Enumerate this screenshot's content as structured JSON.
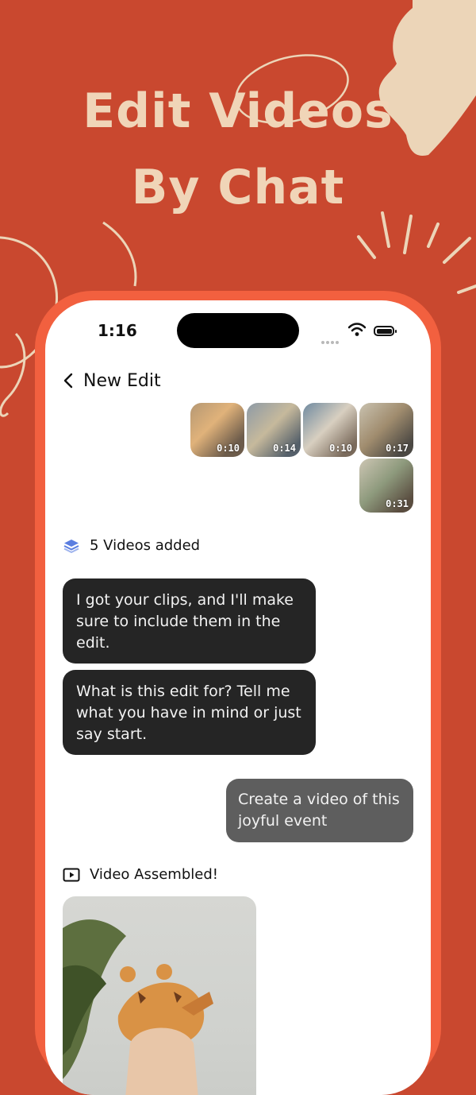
{
  "headline": {
    "line1": "Edit Videos",
    "line2": "By Chat"
  },
  "colors": {
    "background": "#c9482f",
    "phone_frame": "#f2603f",
    "headline": "#f0d5b8",
    "bot_bubble": "#252525",
    "user_bubble": "#5e5e5e"
  },
  "status_bar": {
    "time": "1:16",
    "icons": [
      "cellular-dots-icon",
      "wifi-icon",
      "battery-icon"
    ]
  },
  "nav": {
    "back_icon": "chevron-left-icon",
    "title": "New Edit"
  },
  "clips": [
    {
      "duration": "0:10"
    },
    {
      "duration": "0:14"
    },
    {
      "duration": "0:10"
    },
    {
      "duration": "0:17"
    },
    {
      "duration": "0:31"
    }
  ],
  "videos_added": {
    "icon": "stack-layers-icon",
    "label": "5 Videos added"
  },
  "messages": [
    {
      "from": "assistant",
      "text": "I got your clips, and I'll make sure to include them in the edit."
    },
    {
      "from": "assistant",
      "text": "What is this edit for? Tell me what you have in mind or just say start."
    },
    {
      "from": "user",
      "text": "Create a video of this joyful event"
    }
  ],
  "assembled": {
    "icon": "play-video-icon",
    "label": "Video Assembled!"
  }
}
